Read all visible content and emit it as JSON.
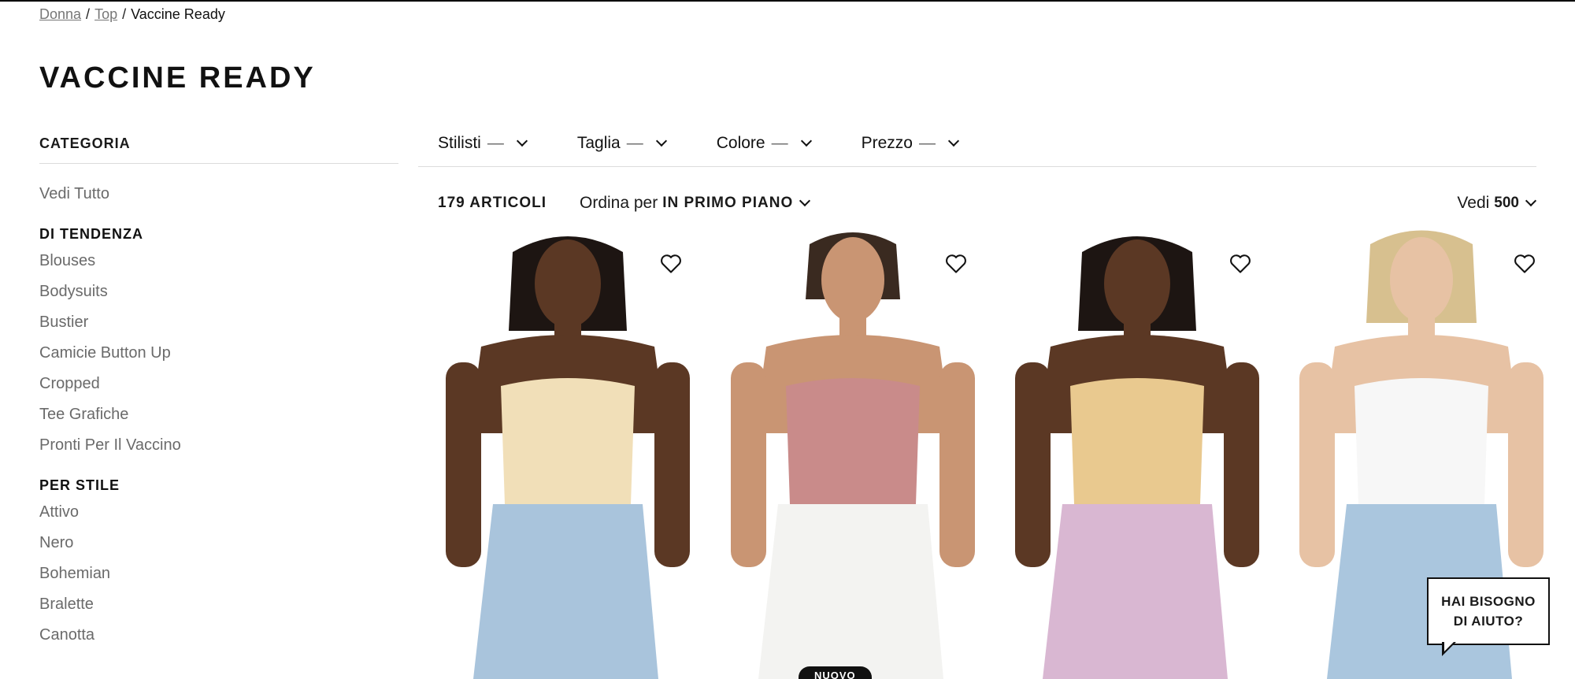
{
  "breadcrumb": {
    "items": [
      "Donna",
      "Top"
    ],
    "current": "Vaccine Ready"
  },
  "page": {
    "title": "VACCINE READY"
  },
  "sidebar": {
    "category_title": "CATEGORIA",
    "view_all": "Vedi Tutto",
    "trending_title": "DI TENDENZA",
    "trending": [
      "Blouses",
      "Bodysuits",
      "Bustier",
      "Camicie Button Up",
      "Cropped",
      "Tee Grafiche",
      "Pronti Per Il Vaccino"
    ],
    "style_title": "PER STILE",
    "styles": [
      "Attivo",
      "Nero",
      "Bohemian",
      "Bralette",
      "Canotta"
    ]
  },
  "filters": [
    {
      "label": "Stilisti",
      "dash": "—"
    },
    {
      "label": "Taglia",
      "dash": "—"
    },
    {
      "label": "Colore",
      "dash": "—"
    },
    {
      "label": "Prezzo",
      "dash": "—"
    }
  ],
  "toolbar": {
    "count": "179 ARTICOLI",
    "sort_label": "Ordina per",
    "sort_value": "IN PRIMO PIANO",
    "view_label": "Vedi",
    "view_value": "500"
  },
  "products": [
    {
      "top": "#f1dfb8",
      "bottom": "#a9c4dc",
      "skin": "#5b3824",
      "hair": "#1d1512"
    },
    {
      "top": "#c98b8a",
      "bottom": "#f3f3f1",
      "skin": "#c99573",
      "hair": "#3a2a20"
    },
    {
      "top": "#e9c98f",
      "bottom": "#d9b7d2",
      "skin": "#5b3824",
      "hair": "#1d1512"
    },
    {
      "top": "#f7f7f7",
      "bottom": "#aac6de",
      "skin": "#e7c2a4",
      "hair": "#d7c08f"
    }
  ],
  "badge": "NUOVO",
  "help": {
    "line1": "HAI BISOGNO",
    "line2": "DI AIUTO?"
  }
}
